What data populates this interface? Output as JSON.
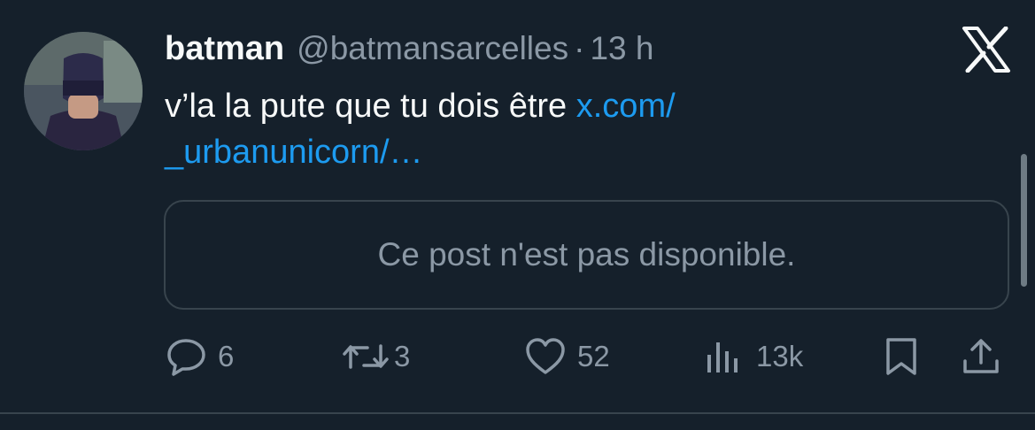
{
  "tweet": {
    "display_name": "batman",
    "handle": "@batmansarcelles",
    "separator": "·",
    "time": "13 h",
    "text": "v’la la pute que tu dois être ",
    "link_text": "x.com/\n_urbanunicorn/…"
  },
  "quoted_card": {
    "message": "Ce post n'est pas disponible."
  },
  "actions": {
    "replies": "6",
    "reposts": "3",
    "likes": "52",
    "views": "13k"
  },
  "icons": {
    "logo": "x-logo-icon",
    "reply": "reply-icon",
    "repost": "repost-icon",
    "like": "heart-icon",
    "views": "views-chart-icon",
    "bookmark": "bookmark-icon",
    "share": "share-icon"
  },
  "colors": {
    "background": "#15202b",
    "text": "#f7f9f9",
    "muted": "#8b98a5",
    "link": "#1d9bf0",
    "border": "#38444d"
  }
}
